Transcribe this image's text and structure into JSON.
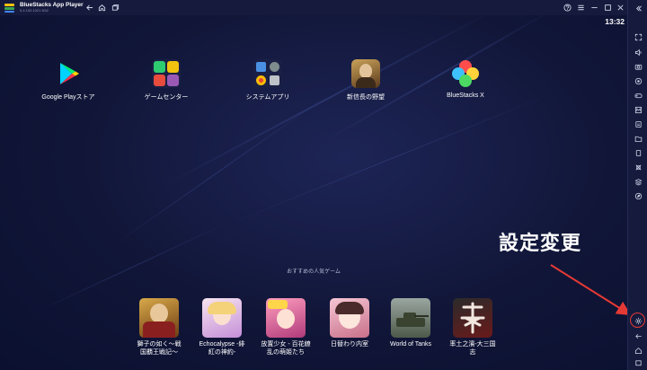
{
  "window": {
    "title": "BlueStacks App Player",
    "version": "5.4.100.1021 N32"
  },
  "status": {
    "time": "13:32"
  },
  "home_apps": [
    {
      "label": "Google Playストア",
      "icon": "google-play-icon"
    },
    {
      "label": "ゲームセンター",
      "icon": "game-center-icon"
    },
    {
      "label": "システムアプリ",
      "icon": "system-apps-icon"
    },
    {
      "label": "新信長の野望",
      "icon": "nobunaga-game-icon"
    },
    {
      "label": "BlueStacks X",
      "icon": "bluestacks-x-icon"
    }
  ],
  "recommended": {
    "title": "おすすめの人気ゲーム",
    "games": [
      {
        "line1": "獅子の如く～戦",
        "line2": "国覇王戦記～"
      },
      {
        "line1": "Echocalypse -緋",
        "line2": "紅の神約-"
      },
      {
        "line1": "放置少女 - 百花繚",
        "line2": "乱の萌姫たち"
      },
      {
        "line1": "日替わり内室",
        "line2": ""
      },
      {
        "line1": "World of Tanks",
        "line2": ""
      },
      {
        "line1": "率土之濱-大三国",
        "line2": "志"
      }
    ]
  },
  "annotation": {
    "text": "設定変更",
    "color": "#e53935"
  },
  "sidebar_icons": [
    "collapse-icon",
    "fullscreen-icon",
    "volume-icon",
    "screenshot-icon",
    "record-icon",
    "controls-icon",
    "macro-icon",
    "apk-icon",
    "folder-icon",
    "rotate-icon",
    "shake-icon",
    "multi-instance-icon",
    "eco-icon",
    "settings-icon",
    "back-icon",
    "home-icon",
    "recent-apps-icon"
  ]
}
